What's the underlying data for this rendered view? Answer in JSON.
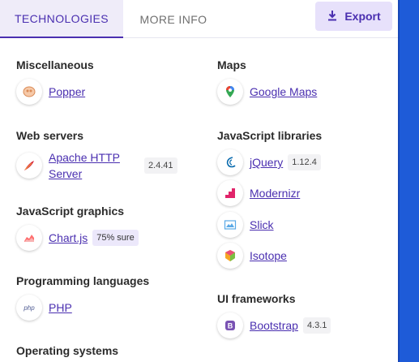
{
  "tabs": {
    "technologies": "TECHNOLOGIES",
    "more_info": "MORE INFO"
  },
  "export_label": "Export",
  "categories": {
    "misc": {
      "title": "Miscellaneous",
      "items": [
        {
          "name": "Popper"
        }
      ]
    },
    "maps": {
      "title": "Maps",
      "items": [
        {
          "name": "Google Maps"
        }
      ]
    },
    "web_servers": {
      "title": "Web servers",
      "items": [
        {
          "name_line1": "Apache HTTP",
          "name_line2": "Server",
          "version": "2.4.41"
        }
      ]
    },
    "js_libraries": {
      "title": "JavaScript libraries",
      "items": [
        {
          "name": "jQuery",
          "version": "1.12.4"
        },
        {
          "name": "Modernizr"
        },
        {
          "name": "Slick"
        },
        {
          "name": "Isotope"
        }
      ]
    },
    "js_graphics": {
      "title": "JavaScript graphics",
      "items": [
        {
          "name": "Chart.js",
          "confidence": "75% sure"
        }
      ]
    },
    "prog_langs": {
      "title": "Programming languages",
      "items": [
        {
          "name": "PHP"
        }
      ]
    },
    "ui_frameworks": {
      "title": "UI frameworks",
      "items": [
        {
          "name": "Bootstrap",
          "version": "4.3.1"
        }
      ]
    },
    "os": {
      "title": "Operating systems"
    }
  },
  "colors": {
    "accent": "#4a2fb0",
    "tab_bg": "#efecf9",
    "export_bg": "#e7e1fb",
    "side_strip": "#1e5bd8"
  }
}
